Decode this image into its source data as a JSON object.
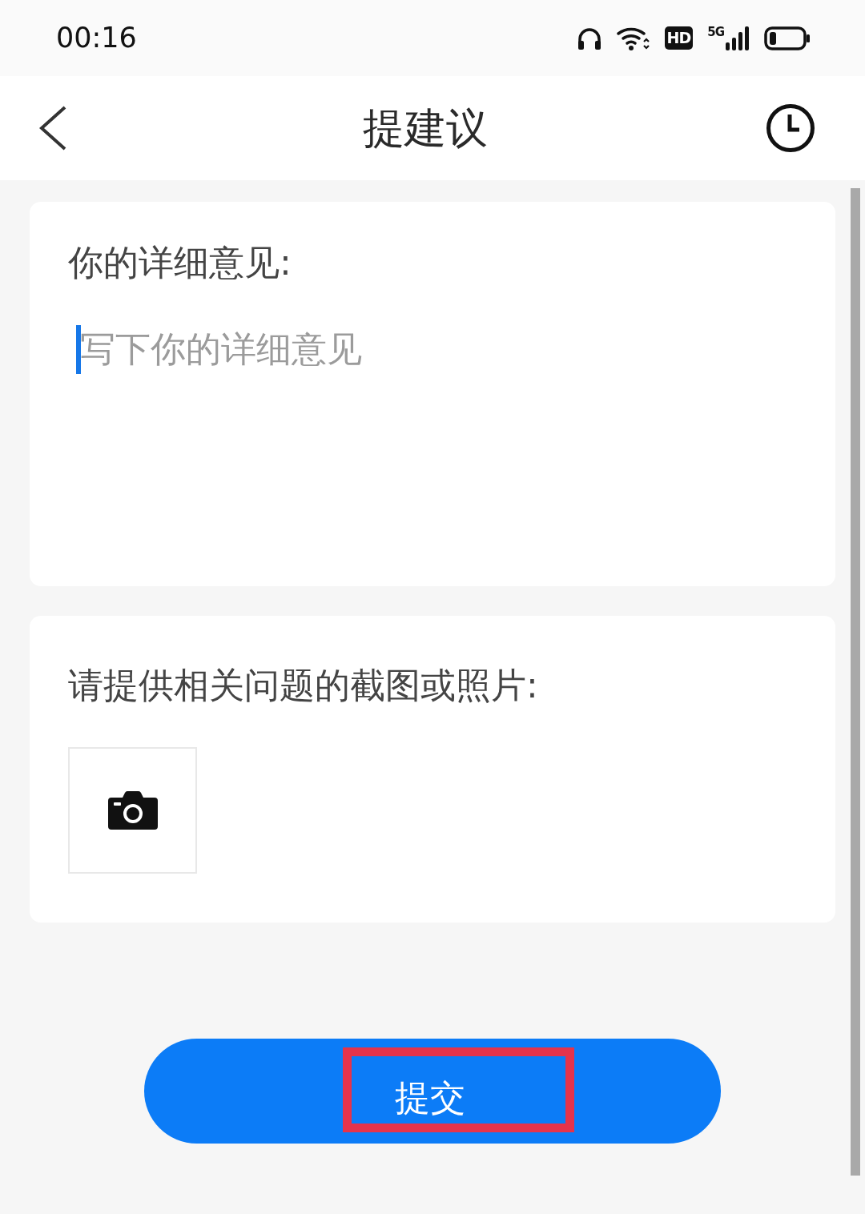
{
  "status_bar": {
    "time": "00:16",
    "hd_badge": "HD",
    "network_type": "5G"
  },
  "header": {
    "title": "提建议"
  },
  "feedback": {
    "label": "你的详细意见:",
    "placeholder": "写下你的详细意见",
    "focused": true
  },
  "screenshots": {
    "label": "请提供相关问题的截图或照片:"
  },
  "submit_button": {
    "label": "提交",
    "highlighted": true
  }
}
